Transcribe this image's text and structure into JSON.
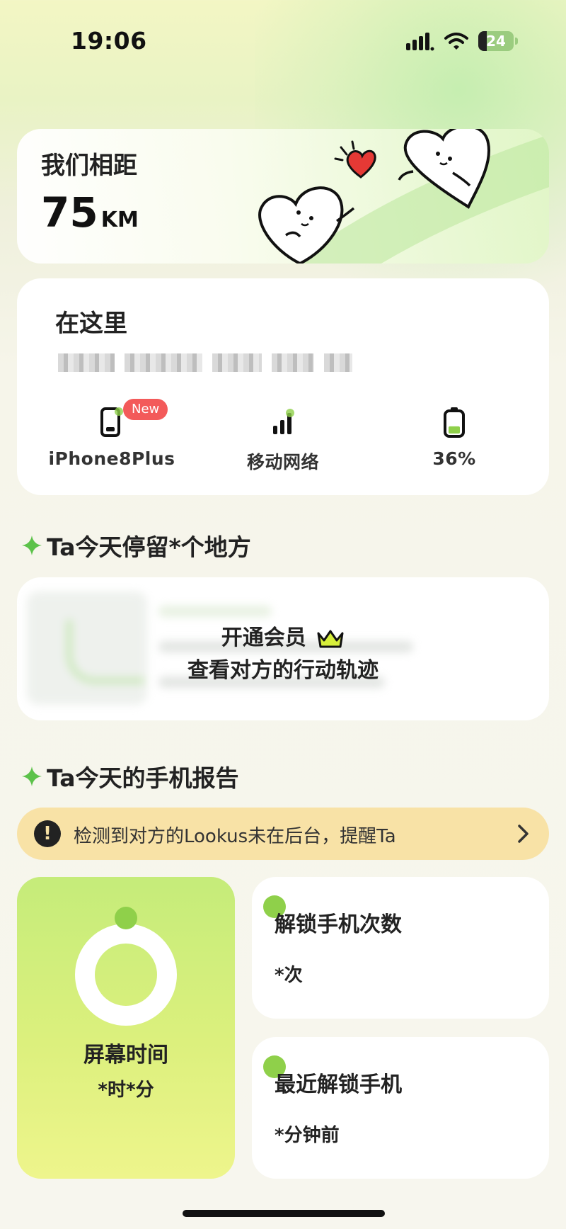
{
  "status_bar": {
    "time": "19:06",
    "battery_level": "24",
    "battery_fraction": 0.24
  },
  "distance": {
    "label": "我们相距",
    "value": "75",
    "unit": "KM"
  },
  "location": {
    "title": "在这里",
    "device": {
      "name": "iPhone8Plus",
      "badge": "New"
    },
    "network": "移动网络",
    "battery": "36%",
    "battery_fraction": 0.36
  },
  "places": {
    "section_title": "Ta今天停留*个地方",
    "vip_line1": "开通会员",
    "vip_line2": "查看对方的行动轨迹"
  },
  "report": {
    "section_title": "Ta今天的手机报告",
    "alert_text": "检测到对方的Lookus未在后台，提醒Ta",
    "screen_time": {
      "label": "屏幕时间",
      "value": "*时*分"
    },
    "unlock_count": {
      "label": "解锁手机次数",
      "value": "*次"
    },
    "last_unlock": {
      "label": "最近解锁手机",
      "value": "*分钟前"
    }
  },
  "colors": {
    "accent_green": "#8fd04a",
    "alert_bg": "#f8e2a6",
    "new_badge": "#f35a5a",
    "heart_red": "#e53935"
  },
  "icons": [
    "signal-icon",
    "wifi-icon",
    "battery-icon",
    "phone-icon",
    "network-signal-icon",
    "battery-status-icon",
    "sparkle-icon",
    "crown-icon",
    "alert-icon",
    "chevron-right-icon"
  ]
}
